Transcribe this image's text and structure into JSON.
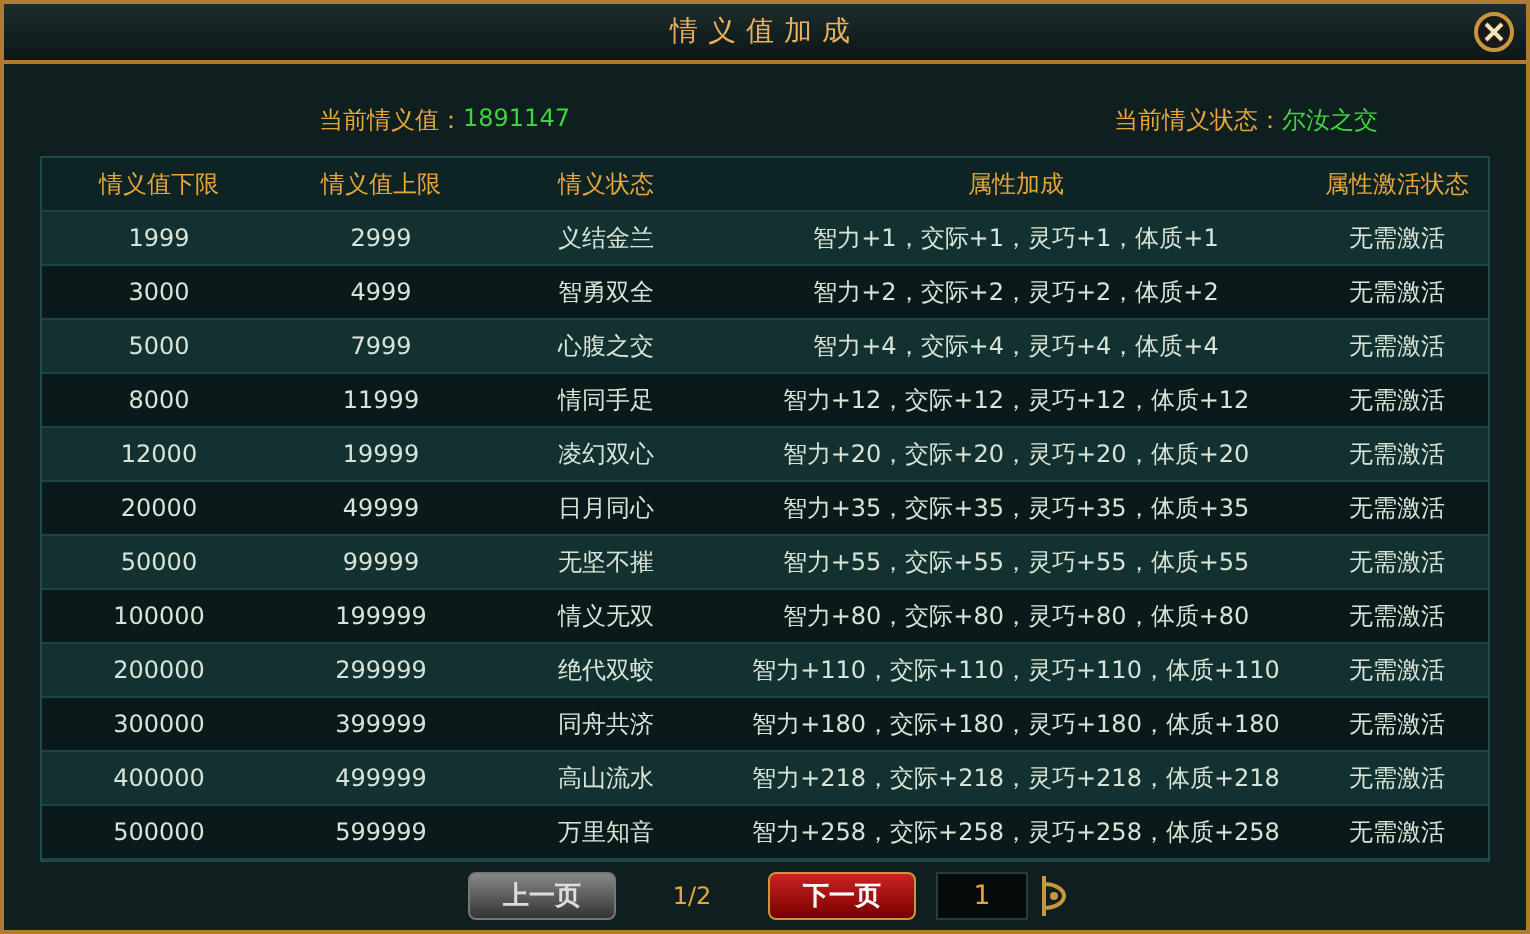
{
  "window": {
    "title": "情义值加成"
  },
  "info": [
    {
      "label": "当前情义值：",
      "value": "1891147"
    },
    {
      "label": "当前情义状态：",
      "value": "尔汝之交"
    }
  ],
  "table": {
    "columns": [
      "情义值下限",
      "情义值上限",
      "情义状态",
      "属性加成",
      "属性激活状态"
    ],
    "rows": [
      [
        "1999",
        "2999",
        "义结金兰",
        "智力+1，交际+1，灵巧+1，体质+1",
        "无需激活"
      ],
      [
        "3000",
        "4999",
        "智勇双全",
        "智力+2，交际+2，灵巧+2，体质+2",
        "无需激活"
      ],
      [
        "5000",
        "7999",
        "心腹之交",
        "智力+4，交际+4，灵巧+4，体质+4",
        "无需激活"
      ],
      [
        "8000",
        "11999",
        "情同手足",
        "智力+12，交际+12，灵巧+12，体质+12",
        "无需激活"
      ],
      [
        "12000",
        "19999",
        "凌幻双心",
        "智力+20，交际+20，灵巧+20，体质+20",
        "无需激活"
      ],
      [
        "20000",
        "49999",
        "日月同心",
        "智力+35，交际+35，灵巧+35，体质+35",
        "无需激活"
      ],
      [
        "50000",
        "99999",
        "无坚不摧",
        "智力+55，交际+55，灵巧+55，体质+55",
        "无需激活"
      ],
      [
        "100000",
        "199999",
        "情义无双",
        "智力+80，交际+80，灵巧+80，体质+80",
        "无需激活"
      ],
      [
        "200000",
        "299999",
        "绝代双蛟",
        "智力+110，交际+110，灵巧+110，体质+110",
        "无需激活"
      ],
      [
        "300000",
        "399999",
        "同舟共济",
        "智力+180，交际+180，灵巧+180，体质+180",
        "无需激活"
      ],
      [
        "400000",
        "499999",
        "高山流水",
        "智力+218，交际+218，灵巧+218，体质+218",
        "无需激活"
      ],
      [
        "500000",
        "599999",
        "万里知音",
        "智力+258，交际+258，灵巧+258，体质+258",
        "无需激活"
      ]
    ]
  },
  "pager": {
    "prev": {
      "label": "上一页",
      "disabled": true
    },
    "page": "1/2",
    "next": {
      "label": "下一页",
      "disabled": false
    },
    "input": "1"
  }
}
